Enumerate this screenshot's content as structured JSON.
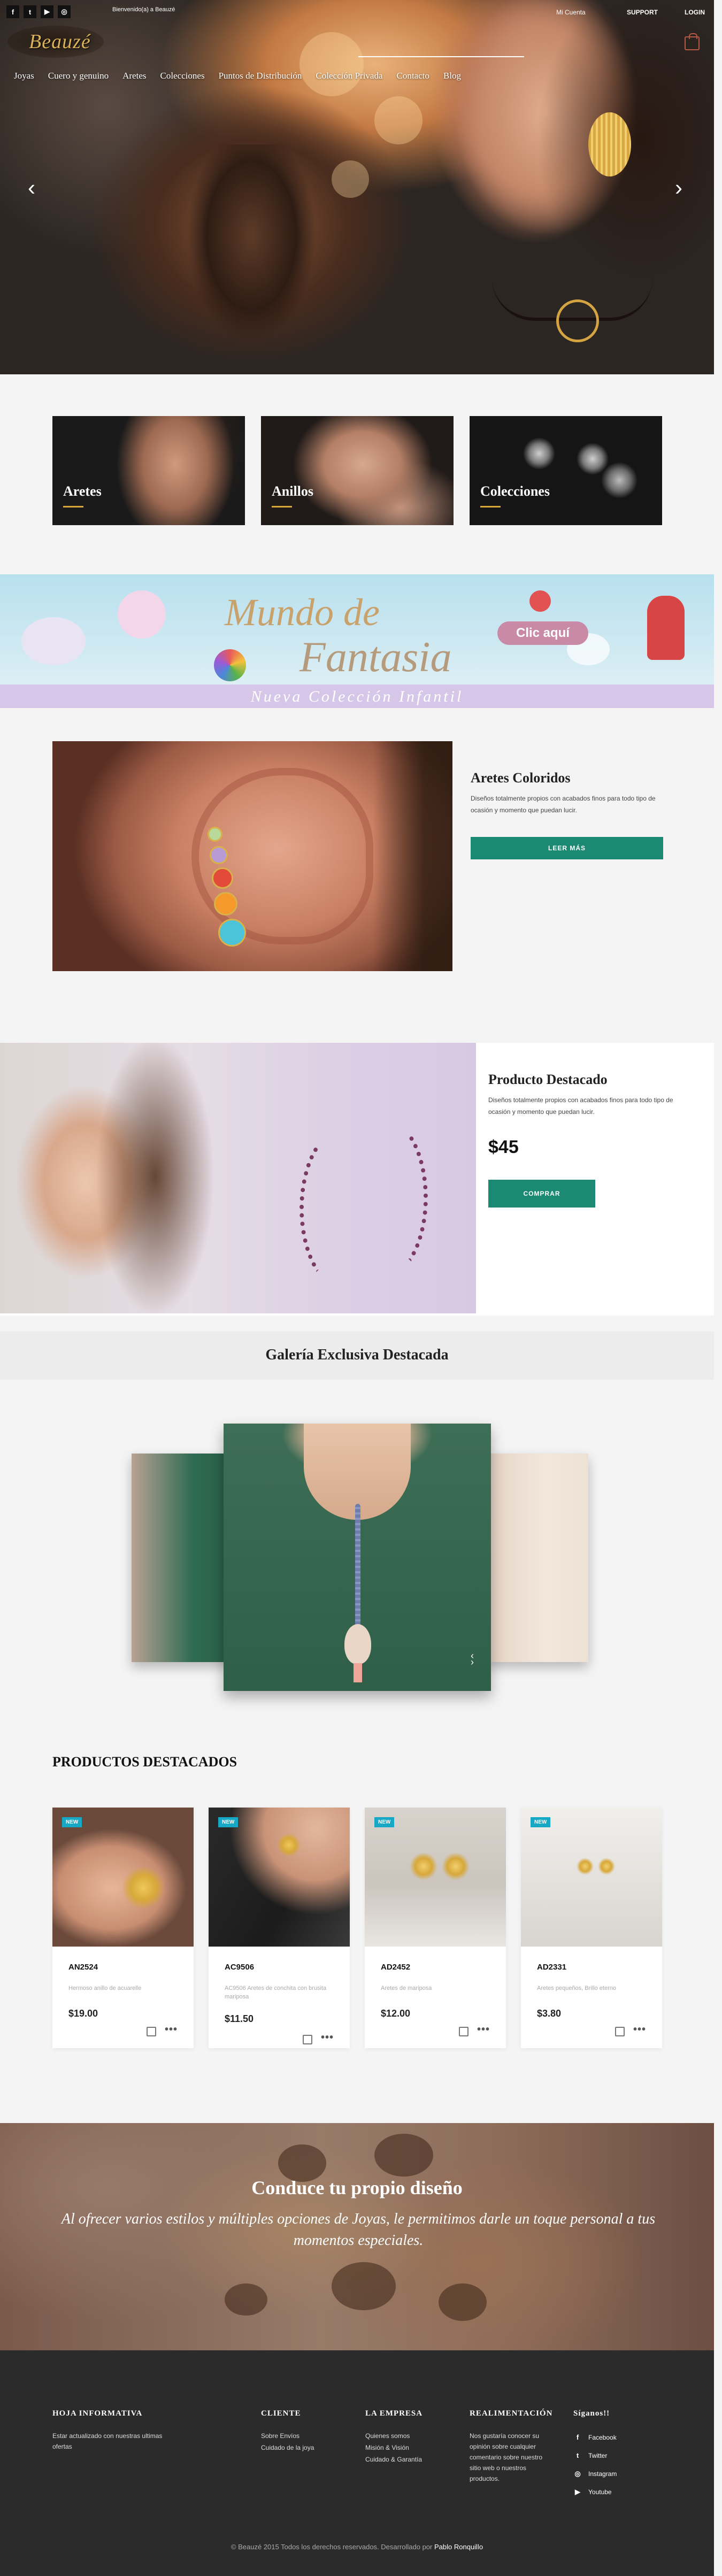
{
  "topbar": {
    "social": [
      "f",
      "t",
      "▶",
      "◎"
    ],
    "small_text": "Bienvenido(a) a Beauzé",
    "account": "Mi Cuenta",
    "support": "SUPPORT",
    "login": "LOGIN"
  },
  "logo": {
    "text": "Beauzé"
  },
  "nav": [
    "Joyas",
    "Cuero y genuino",
    "Aretes",
    "Colecciones",
    "Puntos de Distribución",
    "Colección Privada",
    "Contacto",
    "Blog"
  ],
  "hero": {
    "prev_arrow": "‹",
    "next_arrow": "›"
  },
  "categories": [
    {
      "label": "Aretes"
    },
    {
      "label": "Anillos"
    },
    {
      "label": "Colecciones"
    }
  ],
  "banner": {
    "title_line1": "Mundo de",
    "title_line2": "Fantasia",
    "cta": "Clic aquí",
    "strip": "Nueva Colección Infantil"
  },
  "article": {
    "title": "Aretes Coloridos",
    "desc": "Diseños totalmente propios con acabados finos para todo tipo de ocasión y momento que puedan lucir.",
    "button": "LEER MÁS"
  },
  "featured": {
    "title": "Producto Destacado",
    "desc": "Diseños totalmente propios con acabados finos para todo tipo de ocasión y momento que puedan lucir.",
    "price": "$45",
    "button": "COMPRAR"
  },
  "gallery": {
    "title": "Galería Exclusiva Destacada",
    "nav_prev": "‹",
    "nav_next": "›"
  },
  "products": {
    "heading": "PRODUCTOS DESTACADOS",
    "items": [
      {
        "badge": "NEW",
        "name": "AN2524",
        "desc": "Hermoso anillo de acuarelle",
        "price": "$19.00"
      },
      {
        "badge": "NEW",
        "name": "AC9506",
        "desc": "AC9506 Aretes de conchita con brusita mariposa",
        "price": "$11.50"
      },
      {
        "badge": "NEW",
        "name": "AD2452",
        "desc": "Aretes de mariposa",
        "price": "$12.00"
      },
      {
        "badge": "NEW",
        "name": "AD2331",
        "desc": "Aretes pequeños, Brillo eterno",
        "price": "$3.80"
      }
    ],
    "more": "•••"
  },
  "promo": {
    "title": "Conduce tu propio diseño",
    "text": "Al ofrecer varios estilos y múltiples opciones de Joyas, le permitimos darle un toque personal a tus momentos especiales."
  },
  "footer": {
    "newsletter_title": "HOJA INFORMATIVA",
    "newsletter_text": "Estar actualizado con nuestras ultimas ofertas",
    "client_title": "CLIENTE",
    "client_links": [
      "Sobre Envíos",
      "Cuidado de la joya"
    ],
    "company_title": "LA EMPRESA",
    "company_links": [
      "Quienes somos",
      "Misión & Visión",
      "Cuidado & Garantía"
    ],
    "feedback_title": "REALIMENTACIÓN",
    "feedback_text": "Nos gustaría conocer su opinión sobre cualquier comentario sobre nuestro sitio web o nuestros productos.",
    "social_title": "Síganos!!",
    "social_links": [
      {
        "icon": "f",
        "label": "Facebook"
      },
      {
        "icon": "t",
        "label": "Twitter"
      },
      {
        "icon": "◎",
        "label": "Instagram"
      },
      {
        "icon": "▶",
        "label": "Youtube"
      }
    ],
    "copyright": "© Beauzé 2015 Todos los derechos reservados. Desarrollado por",
    "developer": "Pablo Ronquillo"
  },
  "colors": {
    "accent_green": "#1c8a73",
    "badge_blue": "#17a8c5",
    "gold": "#d8a839",
    "footer_bg": "#2b2b2b"
  }
}
